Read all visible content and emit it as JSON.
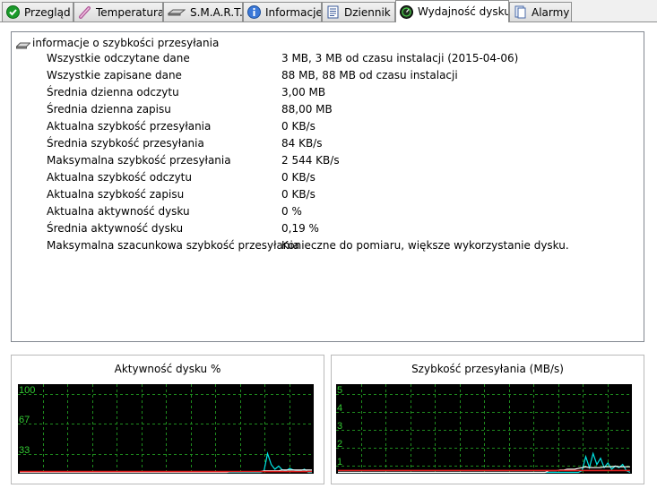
{
  "tabs": [
    {
      "label": "Przegląd",
      "icon": "check-circle-icon",
      "active": false
    },
    {
      "label": "Temperatura",
      "icon": "thermometer-icon",
      "active": false
    },
    {
      "label": "S.M.A.R.T.",
      "icon": "disk-drive-icon",
      "active": false
    },
    {
      "label": "Informacje",
      "icon": "info-icon",
      "active": false
    },
    {
      "label": "Dziennik",
      "icon": "log-document-icon",
      "active": false
    },
    {
      "label": "Wydajność dysku",
      "icon": "speedometer-icon",
      "active": true
    },
    {
      "label": "Alarmy",
      "icon": "alarm-document-icon",
      "active": false
    }
  ],
  "info": {
    "group_title": "informacje o szybkości przesyłania",
    "rows": [
      {
        "label": "Wszystkie odczytane dane",
        "value": "3 MB,  3 MB od czasu instalacji  (2015-04-06)"
      },
      {
        "label": "Wszystkie zapisane dane",
        "value": "88 MB,  88 MB od czasu instalacji"
      },
      {
        "label": "Średnia dzienna odczytu",
        "value": "3,00 MB"
      },
      {
        "label": "Średnia dzienna zapisu",
        "value": "88,00 MB"
      },
      {
        "label": "Aktualna szybkość przesyłania",
        "value": "0 KB/s"
      },
      {
        "label": "Średnia szybkość przesyłania",
        "value": "84 KB/s"
      },
      {
        "label": "Maksymalna szybkość przesyłania",
        "value": "2 544 KB/s"
      },
      {
        "label": "Aktualna szybkość odczytu",
        "value": "0 KB/s"
      },
      {
        "label": "Aktualna szybkość zapisu",
        "value": "0 KB/s"
      },
      {
        "label": "Aktualna aktywność dysku",
        "value": "0 %"
      },
      {
        "label": "Średnia aktywność dysku",
        "value": "0,19 %"
      },
      {
        "label": "Maksymalna szacunkowa szybkość przesyłania",
        "value": "Konieczne do pomiaru, większe wykorzystanie dysku."
      }
    ]
  },
  "colors": {
    "chart_bg": "#000000",
    "grid": "#1e8c1e",
    "axis_label": "#33cc33",
    "activity_line": "#00e5e5",
    "red_line": "#e02020",
    "white_line": "#ffffff"
  },
  "chart_data": [
    {
      "type": "line",
      "title": "Aktywność dysku %",
      "yticks": [
        "100",
        "67",
        "33"
      ],
      "ylim": [
        0,
        100
      ],
      "x": [
        0,
        1,
        2,
        3,
        4,
        5,
        6,
        7,
        8,
        9,
        10,
        11,
        12,
        13,
        14,
        15,
        16,
        17,
        18,
        19,
        20,
        21,
        22,
        23,
        24,
        25,
        26,
        27,
        28,
        29,
        30,
        31,
        32,
        33,
        34,
        35,
        36,
        37,
        38,
        39,
        40,
        41,
        42,
        43,
        44,
        45,
        46,
        47,
        48,
        49,
        50,
        51,
        52,
        53,
        54,
        55,
        56,
        57,
        58,
        59,
        60,
        61,
        62,
        63,
        64,
        65,
        66,
        67,
        68,
        69,
        70,
        71,
        72,
        73,
        74,
        75,
        76,
        77,
        78,
        79
      ],
      "series": [
        {
          "color": "#00e5e5",
          "values": [
            0,
            0,
            0,
            0,
            0,
            0,
            0,
            0,
            0,
            0,
            0,
            0,
            0,
            0,
            0,
            0,
            0,
            0,
            0,
            0,
            0,
            0,
            0,
            0,
            0,
            0,
            0,
            0,
            0,
            0,
            0,
            0,
            0,
            0,
            0,
            0,
            0,
            0,
            0,
            0,
            0,
            0,
            0,
            0,
            0,
            0,
            0,
            0,
            0,
            0,
            0,
            0,
            0,
            0,
            0,
            0,
            0,
            0,
            0,
            0,
            0,
            0,
            0,
            0,
            0,
            0,
            1,
            24,
            10,
            4,
            8,
            3,
            2,
            5,
            3,
            2,
            2,
            4,
            0,
            0
          ]
        },
        {
          "color": "#ffffff",
          "values": [
            0,
            0,
            0,
            0,
            0,
            0,
            0,
            0,
            0,
            0,
            0,
            0,
            0,
            0,
            0,
            0,
            0,
            0,
            0,
            0,
            0,
            0,
            0,
            0,
            0,
            0,
            0,
            0,
            0,
            0,
            0,
            0,
            0,
            0,
            0,
            0,
            0,
            0,
            0,
            0,
            0,
            0,
            0,
            0,
            0,
            0,
            0,
            0,
            0,
            0,
            0,
            0,
            0,
            0,
            0,
            0,
            0,
            1,
            1,
            1,
            1,
            1,
            1,
            1,
            1,
            1,
            2,
            2,
            2,
            2,
            2,
            3,
            3,
            3,
            3,
            3,
            3,
            3,
            3,
            3
          ]
        },
        {
          "color": "#e02020",
          "values": [
            1,
            1,
            1,
            1,
            1,
            1,
            1,
            1,
            1,
            1,
            1,
            1,
            1,
            1,
            1,
            1,
            1,
            1,
            1,
            1,
            1,
            1,
            1,
            1,
            1,
            1,
            1,
            1,
            1,
            1,
            1,
            1,
            1,
            1,
            1,
            1,
            1,
            1,
            1,
            1,
            1,
            1,
            1,
            1,
            1,
            1,
            1,
            1,
            1,
            1,
            1,
            1,
            1,
            1,
            1,
            1,
            1,
            1,
            1,
            1,
            1,
            1,
            1,
            1,
            1,
            1,
            1,
            1,
            1,
            1,
            1,
            1,
            1,
            1,
            1,
            1,
            1,
            1,
            1,
            1
          ]
        }
      ]
    },
    {
      "type": "line",
      "title": "Szybkość przesyłania (MB/s)",
      "yticks": [
        "5",
        "4",
        "3",
        "2",
        "1"
      ],
      "ylim": [
        0,
        5
      ],
      "x": [
        0,
        1,
        2,
        3,
        4,
        5,
        6,
        7,
        8,
        9,
        10,
        11,
        12,
        13,
        14,
        15,
        16,
        17,
        18,
        19,
        20,
        21,
        22,
        23,
        24,
        25,
        26,
        27,
        28,
        29,
        30,
        31,
        32,
        33,
        34,
        35,
        36,
        37,
        38,
        39,
        40,
        41,
        42,
        43,
        44,
        45,
        46,
        47,
        48,
        49,
        50,
        51,
        52,
        53,
        54,
        55,
        56,
        57,
        58,
        59,
        60,
        61,
        62,
        63,
        64,
        65,
        66,
        67,
        68,
        69,
        70,
        71,
        72,
        73,
        74,
        75,
        76,
        77,
        78,
        79
      ],
      "series": [
        {
          "color": "#00e5e5",
          "values": [
            0,
            0,
            0,
            0,
            0,
            0,
            0,
            0,
            0,
            0,
            0,
            0,
            0,
            0,
            0,
            0,
            0,
            0,
            0,
            0,
            0,
            0,
            0,
            0,
            0,
            0,
            0,
            0,
            0,
            0,
            0,
            0,
            0,
            0,
            0,
            0,
            0,
            0,
            0,
            0,
            0,
            0,
            0,
            0,
            0,
            0,
            0,
            0,
            0,
            0,
            0,
            0,
            0,
            0,
            0,
            0,
            0,
            0,
            0,
            0,
            0,
            0,
            0,
            0,
            0,
            0,
            0.1,
            1.0,
            0.3,
            1.2,
            0.5,
            0.9,
            0.3,
            0.6,
            0.2,
            0.4,
            0.3,
            0.5,
            0.1,
            0.0
          ]
        },
        {
          "color": "#ffffff",
          "values": [
            0,
            0,
            0,
            0,
            0,
            0,
            0,
            0,
            0,
            0,
            0,
            0,
            0,
            0,
            0,
            0,
            0,
            0,
            0,
            0,
            0,
            0,
            0,
            0,
            0,
            0,
            0,
            0,
            0,
            0,
            0,
            0,
            0,
            0,
            0,
            0,
            0,
            0,
            0,
            0,
            0,
            0,
            0,
            0,
            0,
            0,
            0,
            0,
            0,
            0,
            0,
            0,
            0,
            0,
            0,
            0,
            0,
            0.1,
            0.1,
            0.1,
            0.15,
            0.15,
            0.2,
            0.2,
            0.2,
            0.25,
            0.3,
            0.35,
            0.3,
            0.3,
            0.3,
            0.3,
            0.35,
            0.35,
            0.35,
            0.4,
            0.35,
            0.35,
            0.35,
            0.35
          ]
        },
        {
          "color": "#e02020",
          "values": [
            0.12,
            0.12,
            0.12,
            0.12,
            0.12,
            0.12,
            0.12,
            0.12,
            0.12,
            0.12,
            0.12,
            0.12,
            0.12,
            0.12,
            0.12,
            0.12,
            0.12,
            0.12,
            0.12,
            0.12,
            0.12,
            0.12,
            0.12,
            0.12,
            0.12,
            0.12,
            0.12,
            0.12,
            0.12,
            0.12,
            0.12,
            0.12,
            0.12,
            0.12,
            0.12,
            0.12,
            0.12,
            0.12,
            0.12,
            0.12,
            0.12,
            0.12,
            0.12,
            0.12,
            0.12,
            0.12,
            0.12,
            0.12,
            0.12,
            0.12,
            0.12,
            0.12,
            0.12,
            0.12,
            0.12,
            0.12,
            0.12,
            0.12,
            0.12,
            0.12,
            0.12,
            0.12,
            0.12,
            0.12,
            0.12,
            0.12,
            0.12,
            0.12,
            0.12,
            0.12,
            0.12,
            0.12,
            0.12,
            0.12,
            0.12,
            0.12,
            0.12,
            0.12,
            0.12,
            0.12
          ]
        }
      ]
    }
  ]
}
